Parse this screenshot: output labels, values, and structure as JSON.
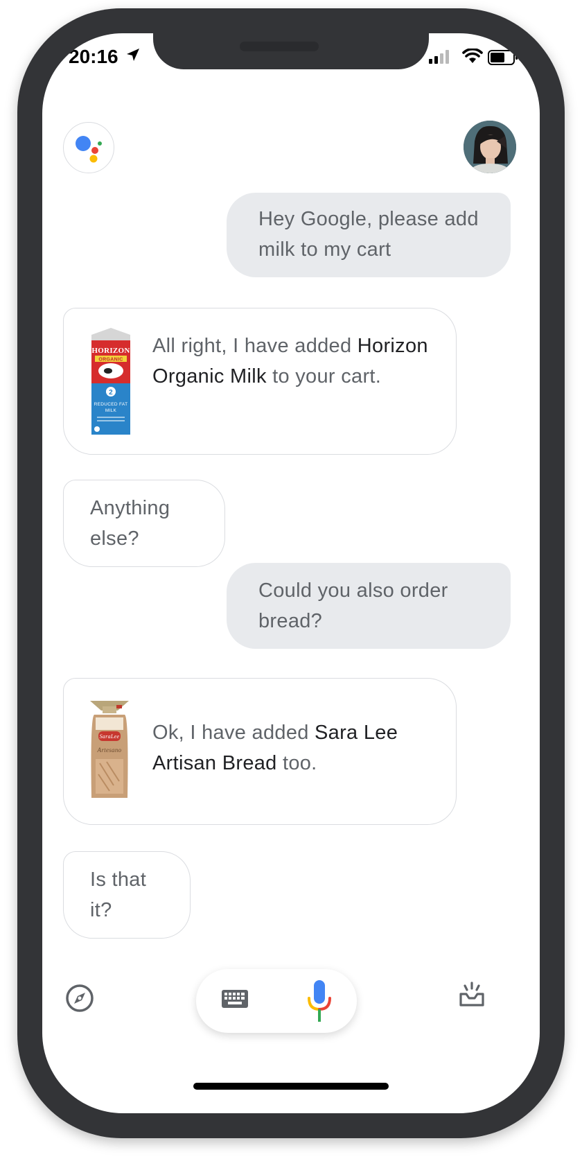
{
  "status_bar": {
    "time": "20:16",
    "icons": [
      "location-arrow-icon",
      "signal-icon",
      "wifi-icon",
      "battery-icon"
    ]
  },
  "header": {
    "assistant_logo": "google-assistant-logo",
    "avatar": "user-avatar"
  },
  "conversation": {
    "user_1": "Hey Google, please add milk to my cart",
    "bot_1": {
      "pre": "All right, I have added ",
      "product": "Horizon Organic Milk",
      "post": " to your cart."
    },
    "bot_2": "Anything else?",
    "user_2": "Could you also order bread?",
    "bot_3": {
      "pre": "Ok, I have added ",
      "product": "Sara Lee Artisan Bread",
      "post": " too."
    },
    "bot_4": "Is that it?"
  },
  "milk_carton": {
    "brand": "HORIZON",
    "line": "ORGANIC",
    "percent": "2",
    "desc1": "REDUCED FAT",
    "desc2": "MILK"
  },
  "bread_bag": {
    "brand": "SaraLee",
    "name": "Artesano"
  },
  "bottom_bar": {
    "icons": [
      "compass-icon",
      "keyboard-icon",
      "mic-icon",
      "tray-icon"
    ]
  },
  "colors": {
    "google_blue": "#4285F4",
    "google_red": "#EA4335",
    "google_yellow": "#FBBC05",
    "google_green": "#34A853",
    "user_bubble": "#e8eaed",
    "text_gray": "#5f6368",
    "text_dark": "#202124",
    "frame": "#333437"
  }
}
